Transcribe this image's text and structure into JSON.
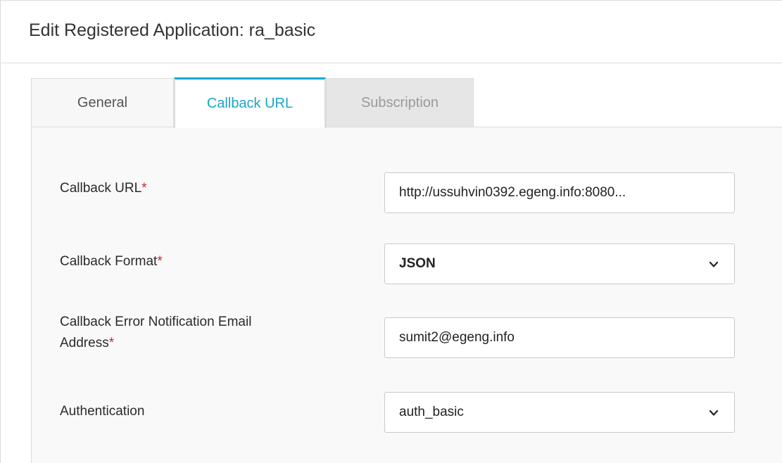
{
  "header": {
    "title": "Edit Registered Application: ra_basic"
  },
  "tabs": [
    {
      "label": "General"
    },
    {
      "label": "Callback URL"
    },
    {
      "label": "Subscription"
    }
  ],
  "form": {
    "required_marker": "*",
    "callback_url": {
      "label": "Callback URL",
      "value": "http://ussuhvin0392.egeng.info:8080..."
    },
    "callback_format": {
      "label": "Callback Format",
      "value": "JSON"
    },
    "error_email": {
      "label_line1": "Callback Error Notification Email",
      "label_line2": "Address",
      "value": "sumit2@egeng.info"
    },
    "authentication": {
      "label": "Authentication",
      "value": "auth_basic"
    }
  },
  "colors": {
    "accent": "#13a8d4",
    "required": "#d0242e"
  },
  "icons": {
    "dropdown": "chevron-down-icon"
  }
}
